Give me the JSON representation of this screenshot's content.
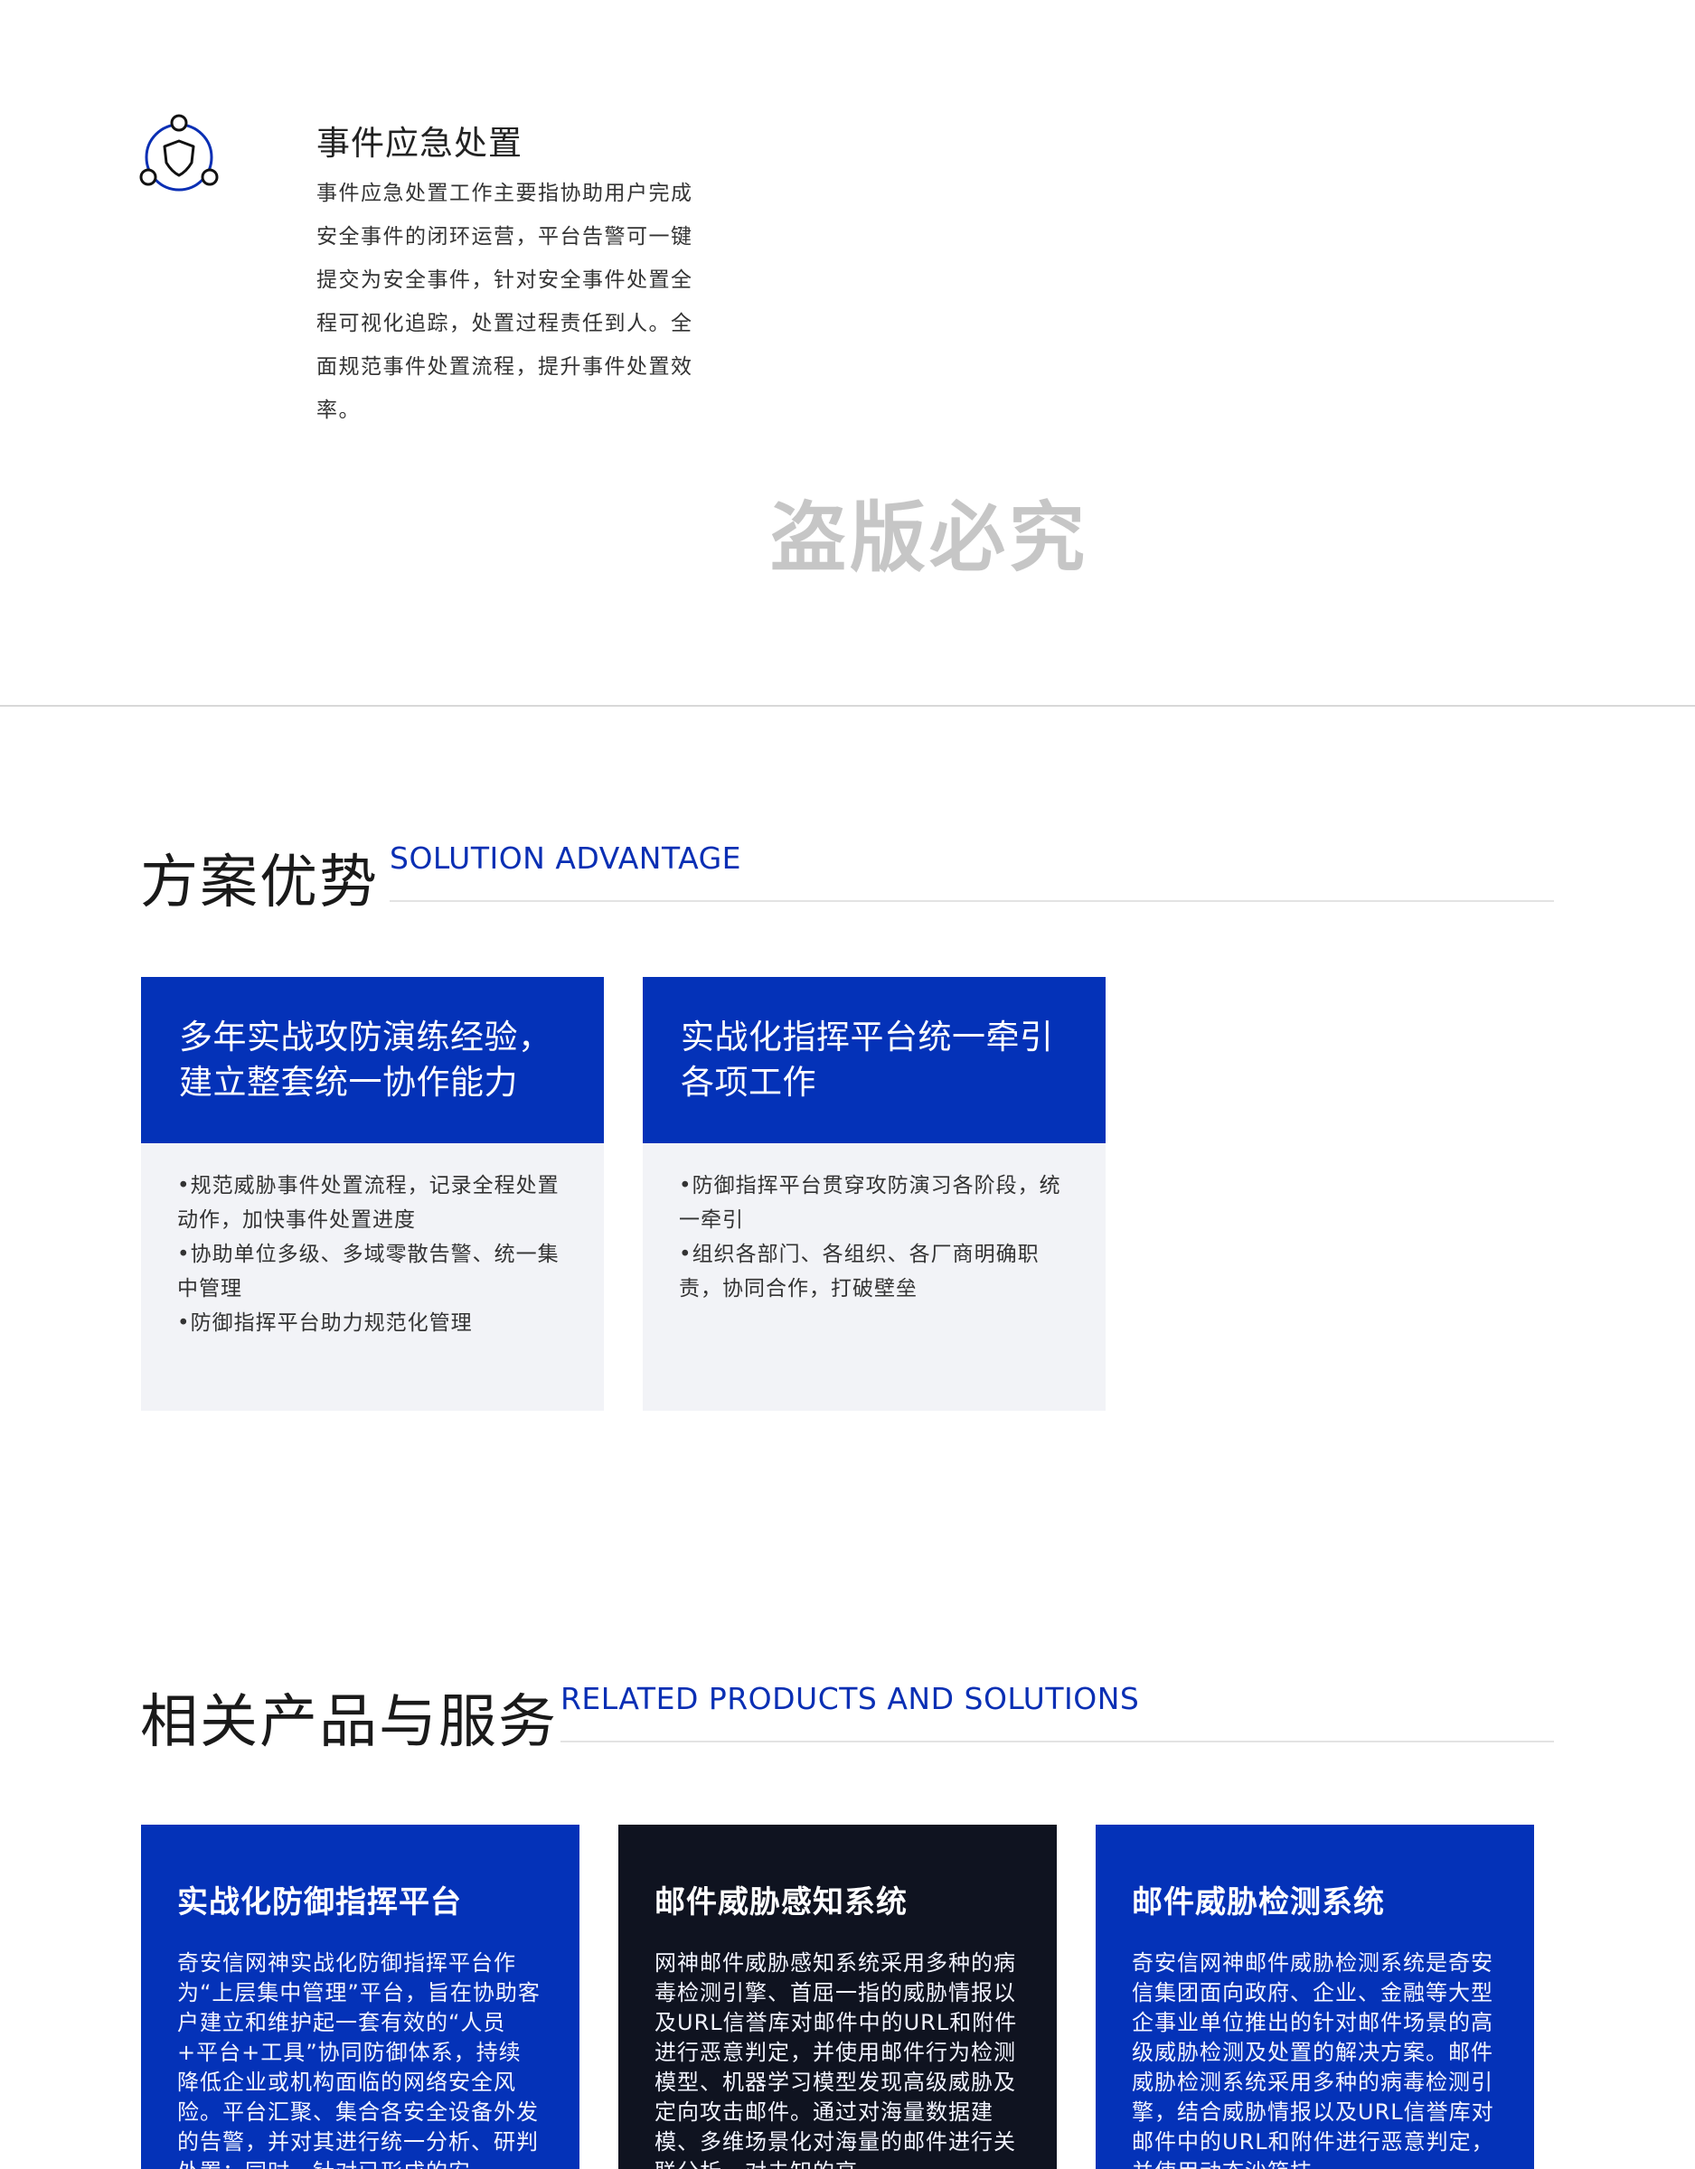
{
  "feature": {
    "icon": "shield-network-icon",
    "title": "事件应急处置",
    "description": "事件应急处置工作主要指协助用户完成安全事件的闭环运营，平台告警可一键提交为安全事件，针对安全事件处置全程可视化追踪，处置过程责任到人。全面规范事件处置流程，提升事件处置效率。"
  },
  "watermark": "盗版必究",
  "advantage": {
    "title_cn": "方案优势",
    "title_en": "SOLUTION ADVANTAGE",
    "cards": [
      {
        "title": "多年实战攻防演练经验，建立整套统一协作能力",
        "items": [
          "•规范威胁事件处置流程，记录全程处置动作，加快事件处置进度",
          "•协助单位多级、多域零散告警、统一集中管理",
          "•防御指挥平台助力规范化管理"
        ]
      },
      {
        "title": "实战化指挥平台统一牵引各项工作",
        "items": [
          "•防御指挥平台贯穿攻防演习各阶段，统一牵引",
          "•组织各部门、各组织、各厂商明确职责，协同合作，打破壁垒"
        ]
      }
    ]
  },
  "products": {
    "title_cn": "相关产品与服务",
    "title_en": "RELATED PRODUCTS AND SOLUTIONS",
    "cards": [
      {
        "title": "实战化防御指挥平台",
        "description": "奇安信网神实战化防御指挥平台作为“上层集中管理”平台，旨在协助客户建立和维护起一套有效的“人员+平台+工具”协同防御体系，持续降低企业或机构面临的网络安全风险。平台汇聚、集合各安全设备外发的告警，并对其进行统一分析、研判处置；同时，针对已形成的安"
      },
      {
        "title": "邮件威胁感知系统",
        "description": "网神邮件威胁感知系统采用多种的病毒检测引擎、首屈一指的威胁情报以及URL信誉库对邮件中的URL和附件进行恶意判定，并使用邮件行为检测模型、机器学习模型发现高级威胁及定向攻击邮件。通过对海量数据建模、多维场景化对海量的邮件进行关联分析，对未知的高"
      },
      {
        "title": "邮件威胁检测系统",
        "description": "奇安信网神邮件威胁检测系统是奇安信集团面向政府、企业、金融等大型企事业单位推出的针对邮件场景的高级威胁检测及处置的解决方案。邮件威胁检测系统采用多种的病毒检测引擎，结合威胁情报以及URL信誉库对邮件中的URL和附件进行恶意判定，并使用动态沙箱技"
      }
    ]
  },
  "colors": {
    "brand_blue": "#0432b8",
    "dark_card": "#0f1320",
    "card_body_bg": "#f2f3f7",
    "watermark": "#c6c6c6"
  }
}
